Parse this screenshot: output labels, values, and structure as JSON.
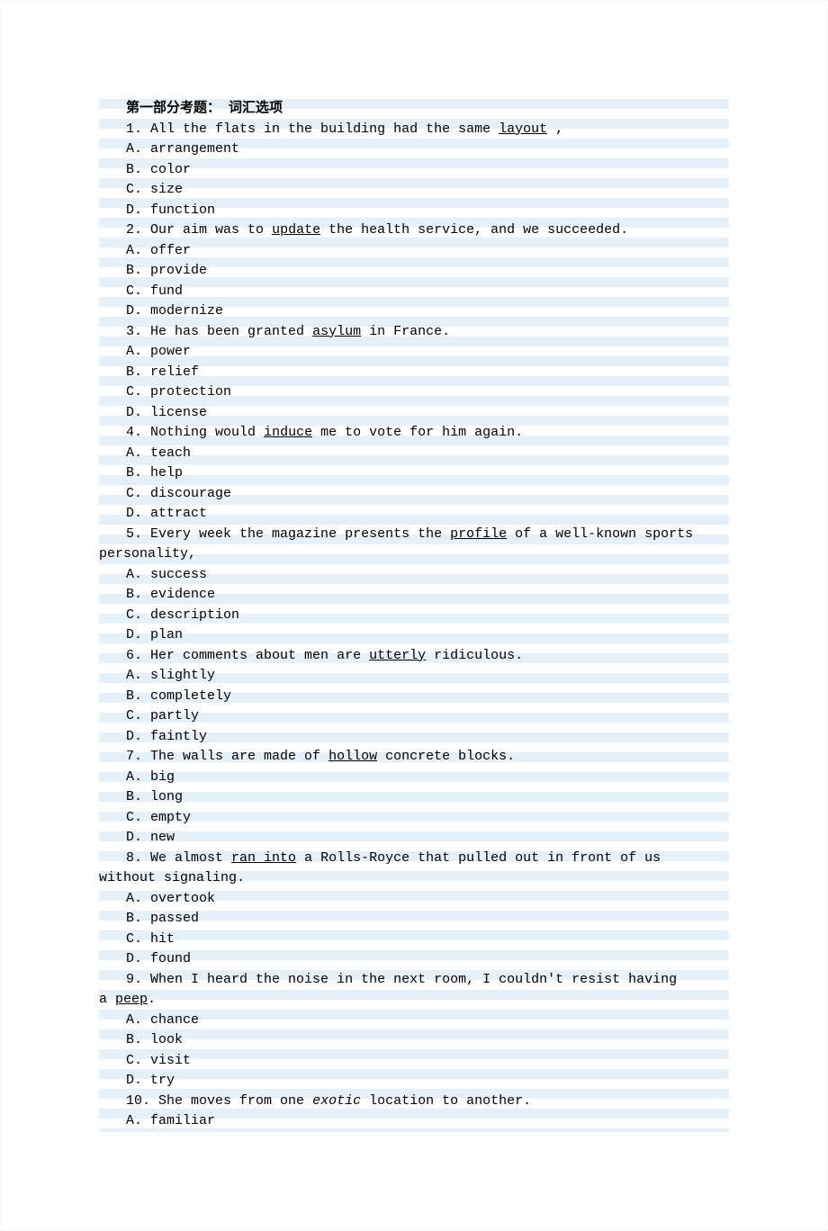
{
  "section_title": "第一部分考题： 词汇选项",
  "questions": [
    {
      "num": "1.",
      "stem_before": "All the flats in the building had the same ",
      "keyword": "layout",
      "stem_after": ",",
      "options": {
        "A": "arrangement",
        "B": "color",
        "C": "size",
        "D": "function"
      }
    },
    {
      "num": "2.",
      "stem_before": "Our aim was to ",
      "keyword": "update",
      "stem_after": " the health service, and we succeeded.",
      "options": {
        "A": "offer",
        "B": "provide",
        "C": "fund",
        "D": "modernize"
      }
    },
    {
      "num": "3.",
      "stem_before": "He has been granted ",
      "keyword": "asylum",
      "stem_after": " in France.",
      "options": {
        "A": "power",
        "B": "relief",
        "C": "protection",
        "D": "license"
      }
    },
    {
      "num": "4.",
      "stem_before": "Nothing would ",
      "keyword": "induce",
      "stem_after": " me to vote for him again.",
      "options": {
        "A": "teach",
        "B": "help",
        "C": "discourage",
        "D": "attract"
      }
    },
    {
      "num": "5.",
      "stem_before": "Every week the magazine presents the ",
      "keyword": "profile",
      "stem_after": " of a well-known sports",
      "cont": "personality,",
      "options": {
        "A": "success",
        "B": "evidence",
        "C": "description",
        "D": "plan"
      }
    },
    {
      "num": "6.",
      "stem_before": "Her comments about men are ",
      "keyword": "utterly",
      "stem_after": " ridiculous.",
      "options": {
        "A": "slightly",
        "B": "completely",
        "C": "partly",
        "D": "faintly"
      }
    },
    {
      "num": "7.",
      "stem_before": "The walls are made of ",
      "keyword": "hollow",
      "stem_after": " concrete blocks.",
      "options": {
        "A": "big",
        "B": "long",
        "C": "empty",
        "D": "new"
      }
    },
    {
      "num": "8.",
      "stem_before": "We almost ",
      "keyword": "ran into",
      "stem_after": " a Rolls-Royce that pulled out in front of us",
      "cont": "without signaling.",
      "options": {
        "A": "overtook",
        "B": "passed",
        "C": "hit",
        "D": "found"
      }
    },
    {
      "num": "9.",
      "stem_before": "When I heard the noise in the next room, I couldn't resist having",
      "keyword": "peep",
      "stem_after": ".",
      "cont_prefix": "a ",
      "options": {
        "A": "chance",
        "B": "look",
        "C": "visit",
        "D": "try"
      }
    },
    {
      "num": "10.",
      "stem_before": "She moves from one ",
      "keyword": "exotic",
      "keyword_style": "italic",
      "stem_after": " location to another.",
      "options": {
        "A": "familiar"
      }
    }
  ]
}
